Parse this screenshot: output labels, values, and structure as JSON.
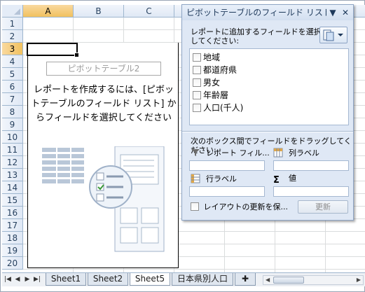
{
  "columns": [
    "A",
    "B",
    "C"
  ],
  "selected_column": "A",
  "rows": [
    "1",
    "2",
    "3",
    "4",
    "5",
    "6",
    "7",
    "8",
    "9",
    "10",
    "11",
    "12",
    "13",
    "14",
    "15",
    "16",
    "17",
    "18",
    "19",
    "20"
  ],
  "selected_row": "3",
  "pivot": {
    "name": "ピボットテーブル2",
    "instruction_line1": "レポートを作成するには、[ピボッ",
    "instruction_line2": "トテーブルのフィールド リスト] か",
    "instruction_line3": "らフィールドを選択してください"
  },
  "field_pane": {
    "title": "ピボットテーブルのフィールド リスト",
    "choose_label_line1": "レポートに追加するフィールドを選択",
    "choose_label_line2": "してください:",
    "fields": [
      "地域",
      "都道府県",
      "男女",
      "年齢層",
      "人口(千人)"
    ],
    "drag_label": "次のボックス間でフィールドをドラッグしてください:",
    "report_filter": "レポート フィル...",
    "column_labels": "列ラベル",
    "row_labels": "行ラベル",
    "values": "値",
    "defer_update": "レイアウトの更新を保...",
    "update_button": "更新"
  },
  "sheet_tabs": [
    "Sheet1",
    "Sheet2",
    "Sheet5",
    "日本県別人口"
  ],
  "active_tab": "Sheet5",
  "colors": {
    "header_bg": "#e4ecf7",
    "selected_header": "#f1c15f",
    "pane_bg": "#dfe8f5",
    "accent_blue": "#1e395b"
  }
}
